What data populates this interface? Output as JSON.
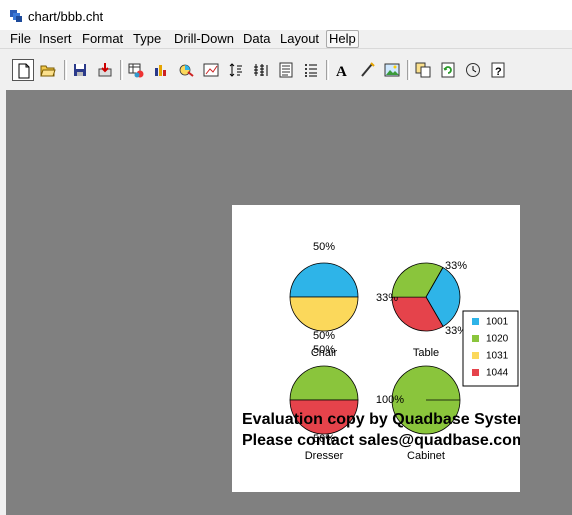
{
  "window": {
    "title": "chart/bbb.cht"
  },
  "menu": [
    {
      "label": "File"
    },
    {
      "label": "Insert"
    },
    {
      "label": "Format"
    },
    {
      "label": "Type"
    },
    {
      "label": "Drill-Down"
    },
    {
      "label": "Data"
    },
    {
      "label": "Layout"
    },
    {
      "label": "Help"
    }
  ],
  "toolbar": [
    {
      "icon": "new-document-icon"
    },
    {
      "icon": "open-folder-icon"
    },
    {
      "icon": "save-icon"
    },
    {
      "icon": "export-icon"
    },
    {
      "icon": "data-source-icon"
    },
    {
      "icon": "chart-type-icon"
    },
    {
      "icon": "pie-chart-icon"
    },
    {
      "icon": "plot-area-icon"
    },
    {
      "icon": "axis-icon"
    },
    {
      "icon": "axis-scale-icon"
    },
    {
      "icon": "legend-icon"
    },
    {
      "icon": "list-icon"
    },
    {
      "icon": "text-icon"
    },
    {
      "icon": "draw-line-icon"
    },
    {
      "icon": "image-icon"
    },
    {
      "icon": "copy-icon"
    },
    {
      "icon": "refresh-icon"
    },
    {
      "icon": "clock-icon"
    },
    {
      "icon": "help-icon"
    }
  ],
  "colors": {
    "1001": "#2eb4e8",
    "1020": "#8ac53c",
    "1031": "#fbd85b",
    "1044": "#e5434b"
  },
  "chart_data": {
    "type": "pie",
    "legend": [
      "1001",
      "1020",
      "1031",
      "1044"
    ],
    "legend_position": "right",
    "pies": [
      {
        "label": "Chair",
        "slices": [
          {
            "series": "1001",
            "percent": 50,
            "label": "50%"
          },
          {
            "series": "1031",
            "percent": 50,
            "label": "50%"
          }
        ]
      },
      {
        "label": "Table",
        "slices": [
          {
            "series": "1001",
            "percent": 33.3,
            "label": "33%"
          },
          {
            "series": "1044",
            "percent": 33.3,
            "label": "33%"
          },
          {
            "series": "1020",
            "percent": 33.3,
            "label": "33%"
          }
        ]
      },
      {
        "label": "Dresser",
        "slices": [
          {
            "series": "1020",
            "percent": 50,
            "label": "50%"
          },
          {
            "series": "1044",
            "percent": 50,
            "label": "50%"
          }
        ]
      },
      {
        "label": "Cabinet",
        "slices": [
          {
            "series": "1020",
            "percent": 100,
            "label": "100%"
          }
        ]
      }
    ]
  },
  "watermark": {
    "line1": "Evaluation copy by Quadbase Systems",
    "line2": "Please contact sales@quadbase.com"
  }
}
